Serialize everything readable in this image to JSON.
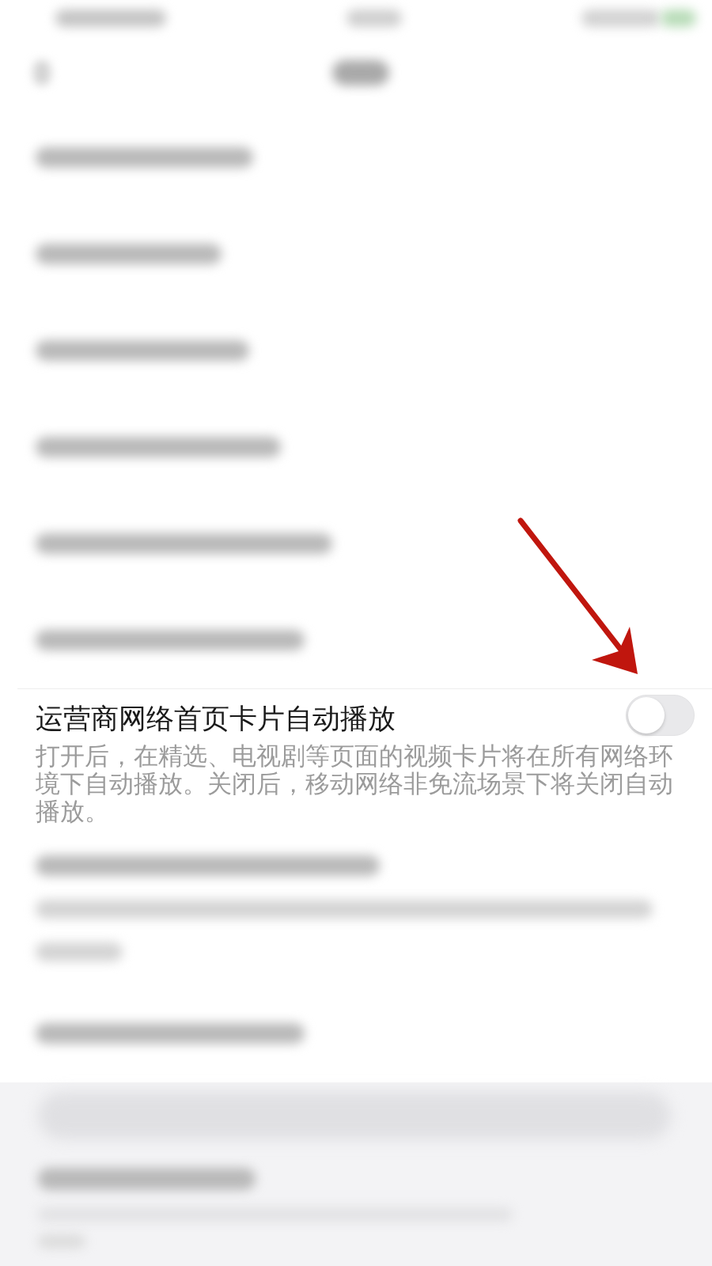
{
  "setting": {
    "title": "运营商网络首页卡片自动播放",
    "description": "打开后，在精选、电视剧等页面的视频卡片将在所有网络环境下自动播放。关闭后，移动网络非免流场景下将关闭自动播放。",
    "on": false
  }
}
